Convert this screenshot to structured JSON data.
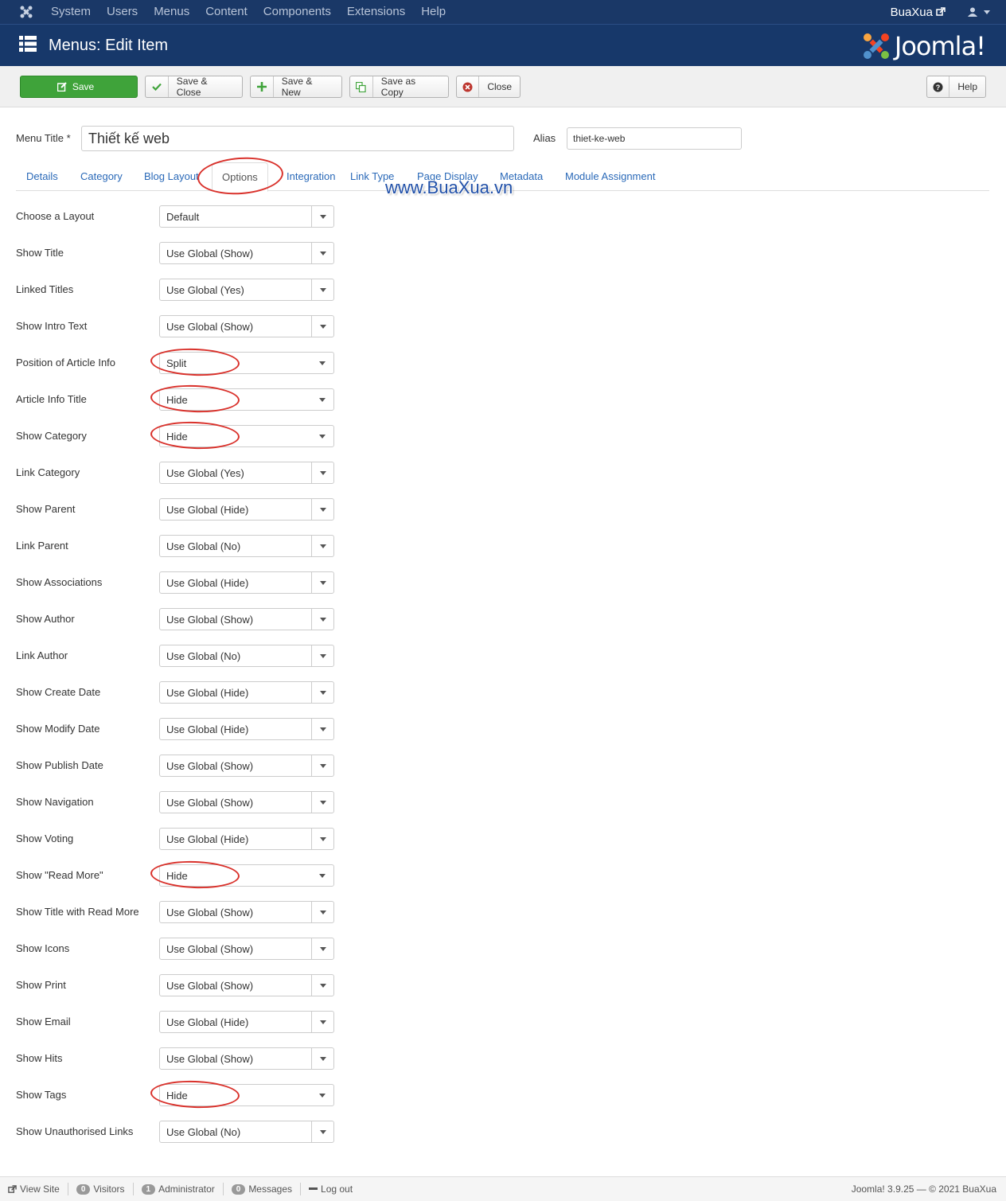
{
  "topbar": {
    "menu": [
      "System",
      "Users",
      "Menus",
      "Content",
      "Components",
      "Extensions",
      "Help"
    ],
    "site_name": "BuaXua"
  },
  "header": {
    "title": "Menus: Edit Item",
    "brand": "Joomla!"
  },
  "toolbar": {
    "save": "Save",
    "save_close": "Save & Close",
    "save_new": "Save & New",
    "save_copy": "Save as Copy",
    "close": "Close",
    "help": "Help"
  },
  "form": {
    "menu_title_label": "Menu Title *",
    "menu_title_value": "Thiết kế web",
    "alias_label": "Alias",
    "alias_value": "thiet-ke-web"
  },
  "tabs": [
    "Details",
    "Category",
    "Blog Layout",
    "Options",
    "Integration",
    "Link Type",
    "Page Display",
    "Metadata",
    "Module Assignment"
  ],
  "watermark": "www.BuaXua.vn",
  "options": [
    {
      "label": "Choose a Layout",
      "value": "Default"
    },
    {
      "label": "Show Title",
      "value": "Use Global (Show)"
    },
    {
      "label": "Linked Titles",
      "value": "Use Global (Yes)"
    },
    {
      "label": "Show Intro Text",
      "value": "Use Global (Show)"
    },
    {
      "label": "Position of Article Info",
      "value": "Split"
    },
    {
      "label": "Article Info Title",
      "value": "Hide"
    },
    {
      "label": "Show Category",
      "value": "Hide"
    },
    {
      "label": "Link Category",
      "value": "Use Global (Yes)"
    },
    {
      "label": "Show Parent",
      "value": "Use Global (Hide)"
    },
    {
      "label": "Link Parent",
      "value": "Use Global (No)"
    },
    {
      "label": "Show Associations",
      "value": "Use Global (Hide)"
    },
    {
      "label": "Show Author",
      "value": "Use Global (Show)"
    },
    {
      "label": "Link Author",
      "value": "Use Global (No)"
    },
    {
      "label": "Show Create Date",
      "value": "Use Global (Hide)"
    },
    {
      "label": "Show Modify Date",
      "value": "Use Global (Hide)"
    },
    {
      "label": "Show Publish Date",
      "value": "Use Global (Show)"
    },
    {
      "label": "Show Navigation",
      "value": "Use Global (Show)"
    },
    {
      "label": "Show Voting",
      "value": "Use Global (Hide)"
    },
    {
      "label": "Show \"Read More\"",
      "value": "Hide"
    },
    {
      "label": "Show Title with Read More",
      "value": "Use Global (Show)"
    },
    {
      "label": "Show Icons",
      "value": "Use Global (Show)"
    },
    {
      "label": "Show Print",
      "value": "Use Global (Show)"
    },
    {
      "label": "Show Email",
      "value": "Use Global (Hide)"
    },
    {
      "label": "Show Hits",
      "value": "Use Global (Show)"
    },
    {
      "label": "Show Tags",
      "value": "Hide"
    },
    {
      "label": "Show Unauthorised Links",
      "value": "Use Global (No)"
    }
  ],
  "statusbar": {
    "view_site": "View Site",
    "visitors_count": "0",
    "visitors": "Visitors",
    "admin_count": "1",
    "administrator": "Administrator",
    "messages_count": "0",
    "messages": "Messages",
    "logout": "Log out",
    "copyright": "Joomla! 3.9.25 — © 2021 BuaXua"
  },
  "colors": {
    "topbar": "#1a3867",
    "header": "#17386a",
    "save_button": "#3fa33a",
    "tab_link": "#2a69b8",
    "annotation": "#d9312b"
  }
}
